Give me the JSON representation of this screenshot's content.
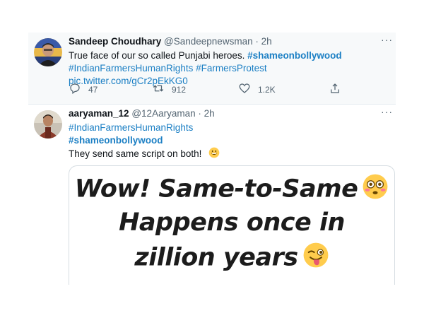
{
  "tweet1": {
    "name": "Sandeep Choudhary",
    "handle": "@Sandeepnewsman",
    "sep": "·",
    "time": "2h",
    "more": "···",
    "text_plain": "True face of our so called Punjabi heroes. ",
    "hashtag_bold": "#shameonbollywood",
    "hashtag_1": "#IndianFarmersHumanRights",
    "hashtag_2": "#FarmersProtest",
    "link": "pic.twitter.com/gCr2pEkKG0",
    "reply_count": "47",
    "retweet_count": "912",
    "like_count": "1.2K"
  },
  "tweet2": {
    "name": "aaryaman_12",
    "handle": "@12Aaryaman",
    "sep": "·",
    "time": "2h",
    "more": "···",
    "hashtag_1": "#IndianFarmersHumanRights",
    "hashtag_bold": "#shameonbollywood",
    "text_plain": "They send same script  on both! ",
    "media": {
      "line1": "Wow! Same-to-Same",
      "line2": "Happens once in",
      "line3": "zillion years"
    }
  },
  "colors": {
    "link": "#1b7fc4",
    "muted": "#536471",
    "highlight_bg": "#f7f9fa"
  },
  "icons": {
    "reply": "reply-icon",
    "retweet": "retweet-icon",
    "like": "heart-icon",
    "share": "share-icon",
    "emoji_grin": "grinning-emoji",
    "emoji_flushed": "flushed-emoji",
    "emoji_wink": "winking-tongue-emoji"
  }
}
